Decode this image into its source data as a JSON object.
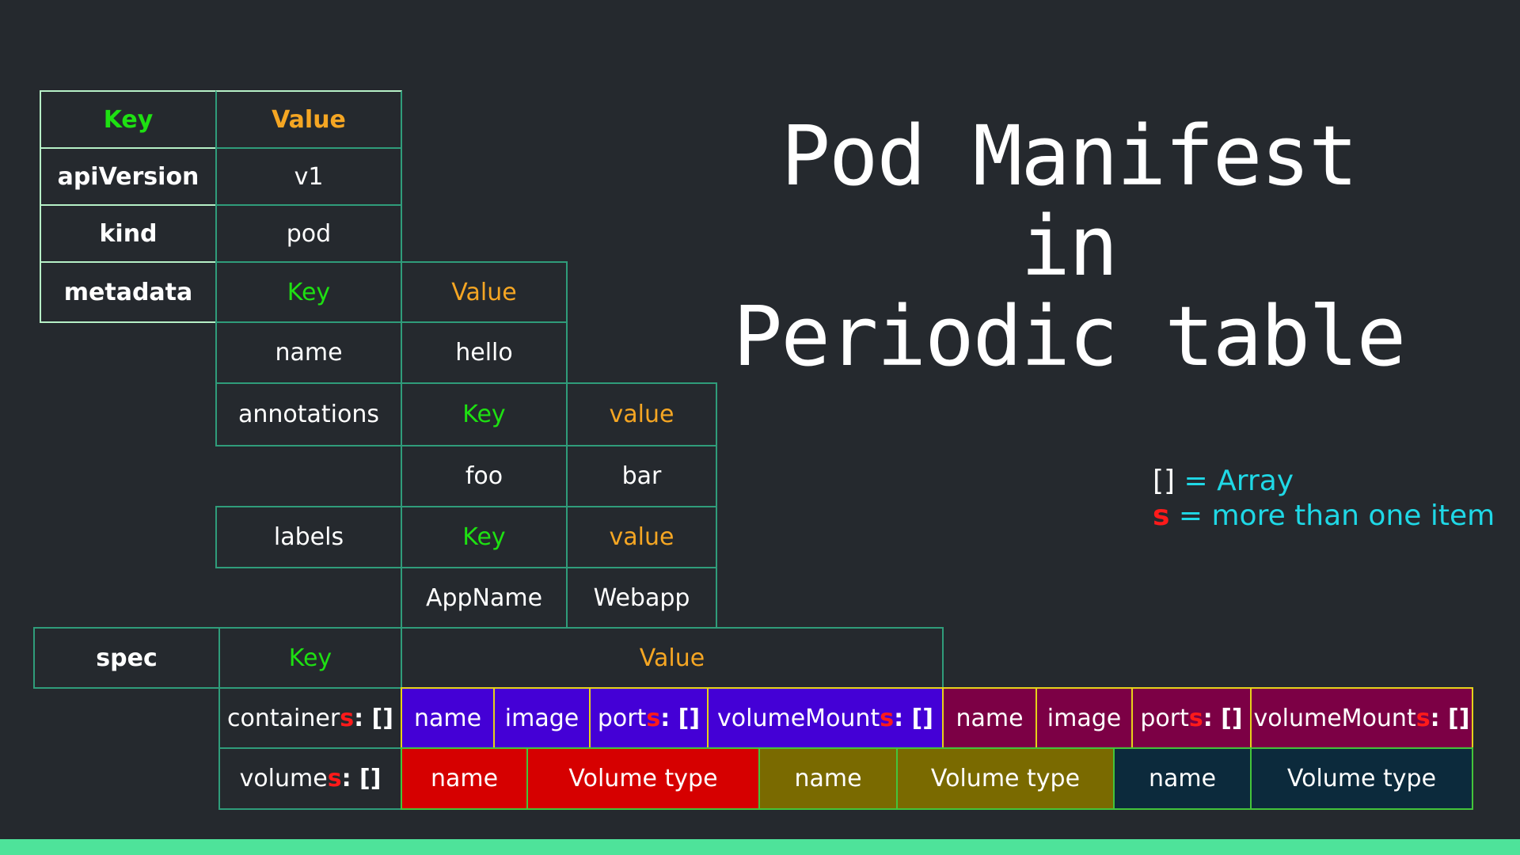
{
  "title": {
    "line1": "Pod Manifest in",
    "line2": "Periodic table"
  },
  "legend": {
    "array_symbol": "[]",
    "array_text": " = Array",
    "plural_symbol": "s",
    "plural_text": " = more than one item"
  },
  "header": {
    "key": "Key",
    "value": "Value"
  },
  "rows": {
    "apiVersion": {
      "key": "apiVersion",
      "value": "v1"
    },
    "kind": {
      "key": "kind",
      "value": "pod"
    },
    "metadata": {
      "key": "metadata",
      "sub_key": "Key",
      "sub_value": "Value",
      "name": {
        "key": "name",
        "value": "hello"
      },
      "annotations": {
        "key": "annotations",
        "k": "Key",
        "v": "value",
        "item_key": "foo",
        "item_value": "bar"
      },
      "labels": {
        "key": "labels",
        "k": "Key",
        "v": "value",
        "item_key": "AppName",
        "item_value": "Webapp"
      }
    },
    "spec": {
      "key": "spec",
      "sub_key": "Key",
      "sub_value": "Value",
      "containers": {
        "label_base": "container",
        "label_s": "s",
        "label_arr": ": []",
        "items": [
          {
            "name": "name",
            "image": "image",
            "ports_base": "port",
            "ports_s": "s",
            "ports_arr": ": []",
            "vm_base": "volumeMount",
            "vm_s": "s",
            "vm_arr": ": []",
            "color": "#4400d6"
          },
          {
            "name": "name",
            "image": "image",
            "ports_base": "port",
            "ports_s": "s",
            "ports_arr": ": []",
            "vm_base": "volumeMount",
            "vm_s": "s",
            "vm_arr": ": []",
            "color": "#7c0045"
          }
        ]
      },
      "volumes": {
        "label_base": "volume",
        "label_s": "s",
        "label_arr": ": []",
        "items": [
          {
            "name": "name",
            "type": "Volume type",
            "color": "#d60000"
          },
          {
            "name": "name",
            "type": "Volume type",
            "color": "#7a6a00"
          },
          {
            "name": "name",
            "type": "Volume type",
            "color": "#0c2a3c"
          }
        ]
      }
    }
  },
  "colors": {
    "background": "#25292e",
    "grid": "#2f9c7a",
    "key": "#1ee012",
    "value": "#f5a623",
    "plural": "#ff1a1a",
    "legend": "#1fd8e6",
    "accent_bar": "#4ee39a"
  }
}
